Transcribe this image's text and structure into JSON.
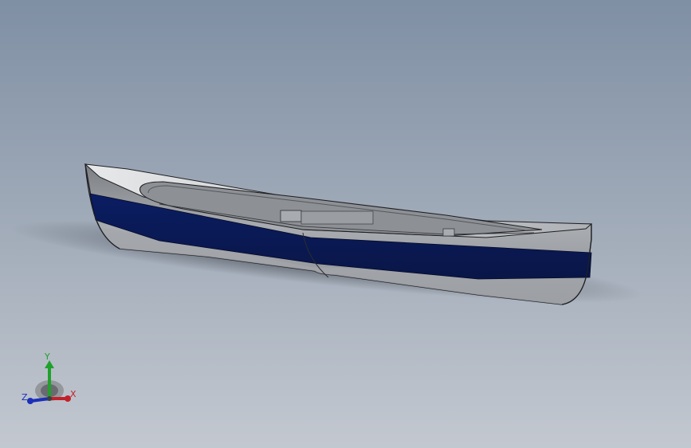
{
  "model": {
    "name": "canoe",
    "colors": {
      "hull": "#8e9196",
      "hull_light": "#b9bcc0",
      "stripe": "#0b1d63",
      "deck": "#d6d8db",
      "outline": "#1e1f22"
    }
  },
  "triad": {
    "x_label": "X",
    "y_label": "Y",
    "z_label": "Z",
    "colors": {
      "x": "#c2212b",
      "y": "#1fa12b",
      "z": "#1b2fb8"
    }
  }
}
